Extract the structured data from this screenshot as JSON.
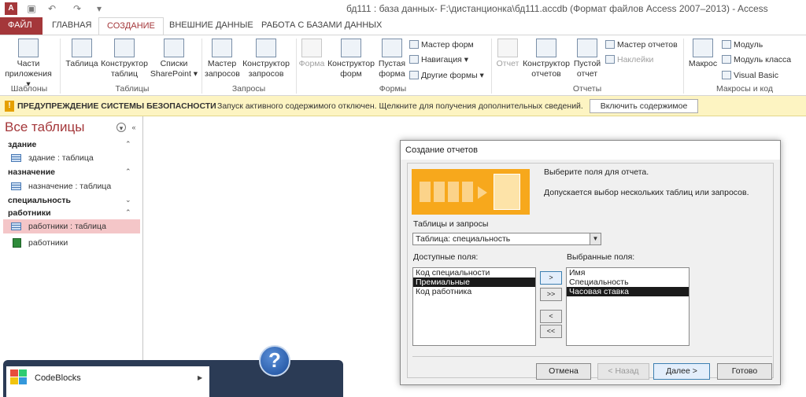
{
  "window": {
    "title": "бд111 : база данных- F:\\дистанционка\\бд111.accdb (Формат файлов Access 2007–2013) - Access",
    "app_icon": "A"
  },
  "ribbon_tabs": [
    "ФАЙЛ",
    "ГЛАВНАЯ",
    "СОЗДАНИЕ",
    "ВНЕШНИЕ ДАННЫЕ",
    "РАБОТА С БАЗАМИ ДАННЫХ"
  ],
  "ribbon": {
    "templates_app_parts": "Части приложения ▾",
    "tables": {
      "table": "Таблица",
      "table_design": "Конструктор таблиц",
      "sharepoint": "Списки SharePoint ▾"
    },
    "queries": {
      "wizard": "Мастер запросов",
      "design": "Конструктор запросов"
    },
    "forms": {
      "form": "Форма",
      "form_design": "Конструктор форм",
      "blank_form": "Пустая форма",
      "form_wizard": "Мастер форм",
      "navigation": "Навигация ▾",
      "more_forms": "Другие формы ▾"
    },
    "reports": {
      "report": "Отчет",
      "report_design": "Конструктор отчетов",
      "blank_report": "Пустой отчет",
      "report_wizard": "Мастер отчетов",
      "labels": "Наклейки"
    },
    "macros": {
      "macro": "Макрос",
      "module": "Модуль",
      "class_module": "Модуль класса",
      "vba": "Visual Basic"
    },
    "group_labels": {
      "templates": "Шаблоны",
      "tables": "Таблицы",
      "queries": "Запросы",
      "forms": "Формы",
      "reports": "Отчеты",
      "macros": "Макросы и код"
    }
  },
  "security_bar": {
    "title": "ПРЕДУПРЕЖДЕНИЕ СИСТЕМЫ БЕЗОПАСНОСТИ",
    "message": "Запуск активного содержимого отключен. Щелкните для получения дополнительных сведений.",
    "button": "Включить содержимое"
  },
  "nav_pane": {
    "header": "Все таблицы",
    "groups": [
      {
        "name": "здание",
        "items": [
          {
            "label": "здание : таблица",
            "kind": "table"
          }
        ]
      },
      {
        "name": "назначение",
        "items": [
          {
            "label": "назначение : таблица",
            "kind": "table"
          }
        ]
      },
      {
        "name": "специальность",
        "items": []
      },
      {
        "name": "работники",
        "items": [
          {
            "label": "работники : таблица",
            "kind": "table",
            "selected": true
          },
          {
            "label": "работники",
            "kind": "report"
          }
        ]
      }
    ]
  },
  "dialog": {
    "title": "Создание отчетов",
    "prompt1": "Выберите поля для отчета.",
    "prompt2": "Допускается выбор нескольких таблиц или запросов.",
    "tables_label": "Таблицы и запросы",
    "tables_value": "Таблица: специальность",
    "available_label": "Доступные поля:",
    "available_fields": [
      "Код специальности",
      "Премиальные",
      "Код работника"
    ],
    "available_selected": "Премиальные",
    "selected_label": "Выбранные поля:",
    "selected_fields": [
      "Имя",
      "Специальность",
      "Часовая ставка"
    ],
    "selected_selected": "Часовая ставка",
    "move_buttons": [
      ">",
      ">>",
      "<",
      "<<"
    ],
    "buttons": {
      "cancel": "Отмена",
      "back": "< Назад",
      "next": "Далее >",
      "finish": "Готово"
    }
  },
  "taskbar": {
    "codeblocks": "CodeBlocks",
    "help_glyph": "?"
  },
  "colors": {
    "access_red": "#a4373a",
    "security_yellow": "#fdf4c2",
    "selection_pink": "#f4c6c8",
    "banner_orange": "#f7a81c"
  }
}
